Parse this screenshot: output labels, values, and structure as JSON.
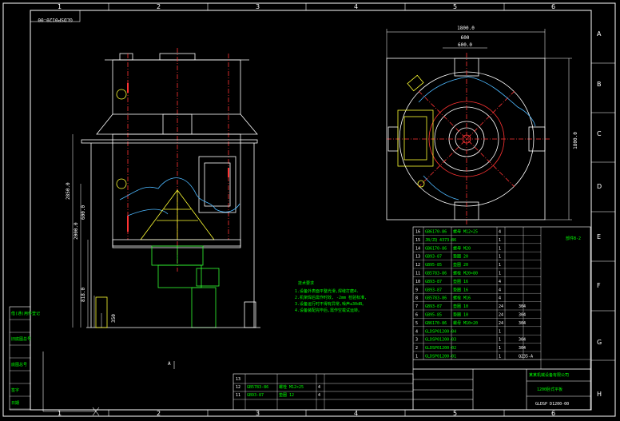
{
  "drawing": {
    "corner_code": "GLDSP0120-00",
    "zones_h": [
      "1",
      "2",
      "3",
      "4",
      "5",
      "6"
    ],
    "zones_v": [
      "A",
      "B",
      "C",
      "D",
      "E",
      "F",
      "G",
      "H"
    ],
    "zone_bottom_right": "6",
    "dims": {
      "plan_width": "1800.0",
      "plan_height": "1800.0",
      "inner_width": "600",
      "inner_sub": "600.0",
      "height_total": "2850.0",
      "height_a": "2000.0",
      "height_b": "600.0",
      "height_c": "818.0",
      "height_d": "350"
    },
    "section_label": "A",
    "tech_notes_title": "技术要求",
    "tech_notes": [
      "1.设备外表面平整光滑,焊缝打磨4.",
      "2.机架焊后需作时效, -2mm 检验标准,",
      "3.设备运行时不得有异常,噪声≤30dB。",
      "4.设备装配完毕后,需作空载试运转。"
    ],
    "parts_list": [
      {
        "no": "16",
        "code": "GB6170-86",
        "name": "螺母 M12×25",
        "qty": "4",
        "mat": ""
      },
      {
        "no": "15",
        "code": "JB/ZQ 4373-86",
        "name": "",
        "qty": "1",
        "mat": ""
      },
      {
        "no": "14",
        "code": "GB6170-86",
        "name": "螺母 M20",
        "qty": "1",
        "mat": ""
      },
      {
        "no": "13",
        "code": "GB93-87",
        "name": "垫圈 20",
        "qty": "1",
        "mat": ""
      },
      {
        "no": "12",
        "code": "GB95-85",
        "name": "垫圈 20",
        "qty": "1",
        "mat": ""
      },
      {
        "no": "11",
        "code": "GB5783-86",
        "name": "螺栓 M20×80",
        "qty": "1",
        "mat": ""
      },
      {
        "no": "10",
        "code": "GB93-87",
        "name": "垫圈 16",
        "qty": "4",
        "mat": ""
      },
      {
        "no": "9",
        "code": "GB93-87",
        "name": "垫圈 16",
        "qty": "4",
        "mat": ""
      },
      {
        "no": "8",
        "code": "GB5783-86",
        "name": "螺栓 M16",
        "qty": "4",
        "mat": ""
      },
      {
        "no": "7",
        "code": "GB93-87",
        "name": "垫圈 10",
        "qty": "24",
        "mat": "304"
      },
      {
        "no": "6",
        "code": "GB95-85",
        "name": "垫圈 10",
        "qty": "24",
        "mat": "304"
      },
      {
        "no": "5",
        "code": "GB6170-86",
        "name": "螺母 M10×20",
        "qty": "24",
        "mat": "304"
      },
      {
        "no": "4",
        "code": "GLDSP01200-04",
        "name": "",
        "qty": "1",
        "mat": ""
      },
      {
        "no": "3",
        "code": "GLDSP01200-03",
        "name": "",
        "qty": "1",
        "mat": "304"
      },
      {
        "no": "2",
        "code": "GLDSP01200-02",
        "name": "",
        "qty": "1",
        "mat": "304"
      },
      {
        "no": "1",
        "code": "GLDSP01200-01",
        "name": "",
        "qty": "1",
        "mat": "Q235-A"
      }
    ],
    "parts_side_note": "部件B-2",
    "small_table": [
      {
        "no": "13",
        "code": "",
        "name": "",
        "qty": ""
      },
      {
        "no": "12",
        "code": "GB5783-86",
        "name": "螺栓 M12×25",
        "qty": "4"
      },
      {
        "no": "11",
        "code": "GB93-87",
        "name": "垫圈 12",
        "qty": "4"
      }
    ],
    "title_block": {
      "company": "某某机械设备有限公司",
      "drawing_name": "1200卧式平板",
      "drawing_no": "GLDSP D1200-00"
    },
    "left_strip": [
      "借(通)用件登记",
      "",
      "旧底图总号",
      "",
      "底图总号",
      "",
      "签字",
      "日期"
    ]
  }
}
